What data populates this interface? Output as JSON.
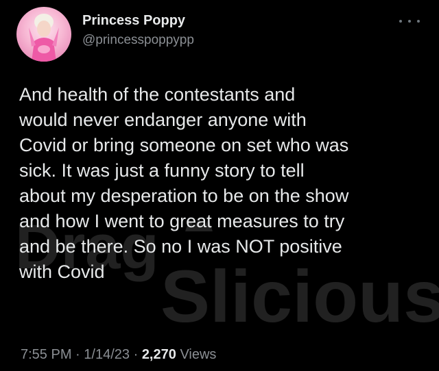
{
  "author": {
    "name": "Princess Poppy",
    "handle": "@princesspoppypp"
  },
  "tweet": {
    "text": "And health of the contestants and\nwould never endanger anyone with\nCovid or bring someone on set who was\nsick. It was just a funny story to tell\nabout my desperation to be on the show\nand how I went to great measures to try\nand be there. So no I was NOT positive\nwith Covid",
    "time": "7:55 PM",
    "separator": "·",
    "date": "1/14/23",
    "views_count": "2,270",
    "views_label": "Views"
  },
  "more_icon": "more-horizontal-icon",
  "watermark": {
    "line1": "Drag",
    "line2": "Slicious"
  },
  "colors": {
    "background": "#000000",
    "primary_text": "#e7e9ea",
    "secondary_text": "#8b8f94",
    "avatar_accent": "#f48ec2"
  }
}
